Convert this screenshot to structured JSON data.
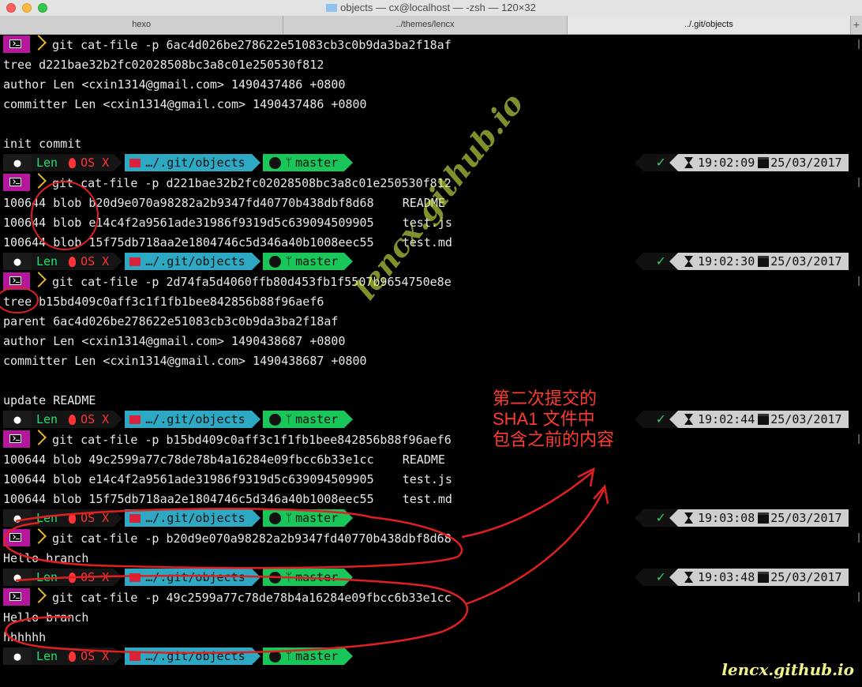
{
  "window": {
    "title": "objects — cx@localhost — -zsh — 120×32"
  },
  "tabs": [
    {
      "label": "hexo"
    },
    {
      "label": "../themes/lencx"
    },
    {
      "label": "../.git/objects"
    }
  ],
  "tab_plus": "+",
  "prompt": {
    "user": "Len",
    "os": "OS X",
    "path": "…/.git/objects",
    "branch": "master",
    "status": "✓"
  },
  "commands": [
    "git cat-file -p 6ac4d026be278622e51083cb3c0b9da3ba2f18af",
    "git cat-file -p d221bae32b2fc02028508bc3a8c01e250530f812",
    "git cat-file -p 2d74fa5d4060ffb80d453fb1f5507b9654750e8e",
    "git cat-file -p b15bd409c0aff3c1f1fb1bee842856b88f96aef6",
    "git cat-file -p b20d9e070a98282a2b9347fd40770b438dbf8d68",
    "git cat-file -p 49c2599a77c78de78b4a16284e09fbcc6b33e1cc"
  ],
  "output": {
    "o1": "tree d221bae32b2fc02028508bc3a8c01e250530f812",
    "o2": "author Len <cxin1314@gmail.com> 1490437486 +0800",
    "o3": "committer Len <cxin1314@gmail.com> 1490437486 +0800",
    "o4": "init commit",
    "o5": "100644 blob b20d9e070a98282a2b9347fd40770b438dbf8d68    README",
    "o6": "100644 blob e14c4f2a9561ade31986f9319d5c639094509905    test.js",
    "o7": "100644 blob 15f75db718aa2e1804746c5d346a40b1008eec55    test.md",
    "o8": "tree b15bd409c0aff3c1f1fb1bee842856b88f96aef6",
    "o9": "parent 6ac4d026be278622e51083cb3c0b9da3ba2f18af",
    "o10": "author Len <cxin1314@gmail.com> 1490438687 +0800",
    "o11": "committer Len <cxin1314@gmail.com> 1490438687 +0800",
    "o12": "update README",
    "o13": "100644 blob 49c2599a77c78de78b4a16284e09fbcc6b33e1cc    README",
    "o14": "100644 blob e14c4f2a9561ade31986f9319d5c639094509905    test.js",
    "o15": "100644 blob 15f75db718aa2e1804746c5d346a40b1008eec55    test.md",
    "o16": "Hello branch",
    "o17": "Hello branch",
    "o18": "hhhhhh"
  },
  "right_status": [
    {
      "time": "19:02:09",
      "date": "25/03/2017"
    },
    {
      "time": "19:02:30",
      "date": "25/03/2017"
    },
    {
      "time": "19:02:44",
      "date": "25/03/2017"
    },
    {
      "time": "19:03:08",
      "date": "25/03/2017"
    },
    {
      "time": "19:03:48",
      "date": "25/03/2017"
    }
  ],
  "annotation": {
    "line1": "第二次提交的",
    "line2": "SHA1 文件中",
    "line3": "包含之前的内容"
  },
  "watermark": "lencx.github.io",
  "brand": "lencx.github.io",
  "colors": {
    "annotation": "#ff3b30",
    "prompt_green": "#19e36f",
    "path_cyan": "#2ea9c4",
    "branch_green": "#19c65a"
  }
}
